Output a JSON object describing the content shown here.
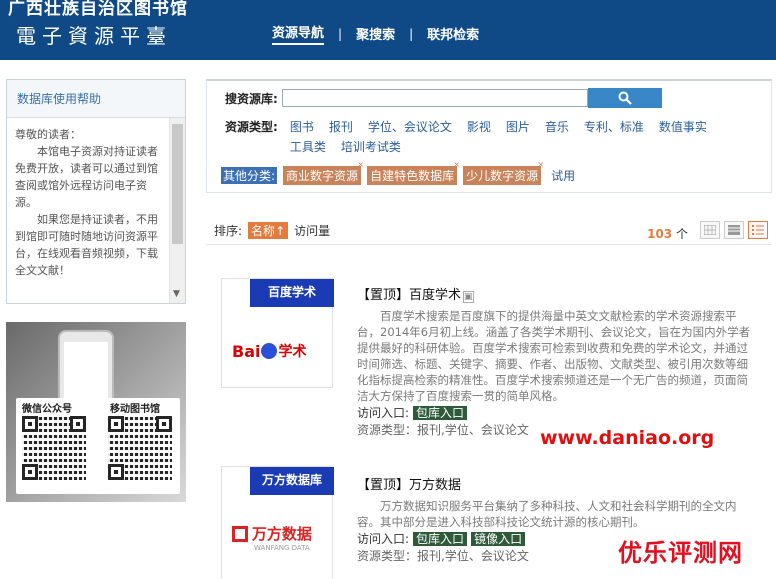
{
  "header": {
    "library_name": "广西壮族自治区图书馆",
    "subtitle": "電子資源平臺",
    "nav": [
      "资源导航",
      "聚搜索",
      "联邦检索"
    ]
  },
  "help": {
    "title": "数据库使用帮助",
    "greeting": "尊敬的读者：",
    "para1": "本馆电子资源对持证读者免费开放，读者可以通过到馆查阅或馆外远程访问电子资源。",
    "para2": "如果您是持证读者，不用到馆即可随时随地访问资源平台，在线观看音频视频，下载全文文献！"
  },
  "qr": {
    "label_left": "微信公众号",
    "label_right": "移动图书馆"
  },
  "search": {
    "label": "搜资源库:",
    "value": "",
    "button_icon": "search-icon"
  },
  "types": {
    "label": "资源类型:",
    "items": [
      "图书",
      "报刊",
      "学位、会议论文",
      "影视",
      "图片",
      "音乐",
      "专利、标准",
      "数值事实",
      "工具类",
      "培训考试类"
    ]
  },
  "other": {
    "label": "其他分类:",
    "tags": [
      "商业数字资源",
      "自建特色数据库",
      "少儿数字资源"
    ],
    "plain": "试用"
  },
  "sort": {
    "label": "排序:",
    "active": "名称",
    "other": "访问量",
    "count_num": "103",
    "count_unit": "个"
  },
  "entries": [
    {
      "thumb_label": "百度学术",
      "thumb_brand": "Bai学术",
      "title": "【置顶】百度学术",
      "desc": "百度学术搜索是百度旗下的提供海量中英文文献检索的学术资源搜索平台，2014年6月初上线。涵盖了各类学术期刊、会议论文，旨在为国内外学者提供最好的科研体验。百度学术搜索可检索到收费和免费的学术论文，并通过时间筛选、标题、关键字、摘要、作者、出版物、文献类型、被引用次数等细化指标提高检索的精准性。百度学术搜索频道还是一个无广告的频道，页面简洁大方保持了百度搜索一贯的简单风格。",
      "access_label": "访问入口:",
      "access_btns": [
        "包库入口"
      ],
      "type_text": "资源类型：报刊,学位、会议论文"
    },
    {
      "thumb_label": "万方数据库",
      "thumb_brand": "万方数据",
      "thumb_brand_en": "WANFANG DATA",
      "title": "【置顶】万方数据",
      "desc": "万方数据知识服务平台集纳了多种科技、人文和社会科学期刊的全文内容。其中部分是进入科技部科技论文统计源的核心期刊。",
      "access_label": "访问入口:",
      "access_btns": [
        "包库入口",
        "镜像入口"
      ],
      "type_text": "资源类型：报刊,学位、会议论文"
    }
  ],
  "watermarks": [
    "www.daniao.org",
    "优乐评测网"
  ]
}
